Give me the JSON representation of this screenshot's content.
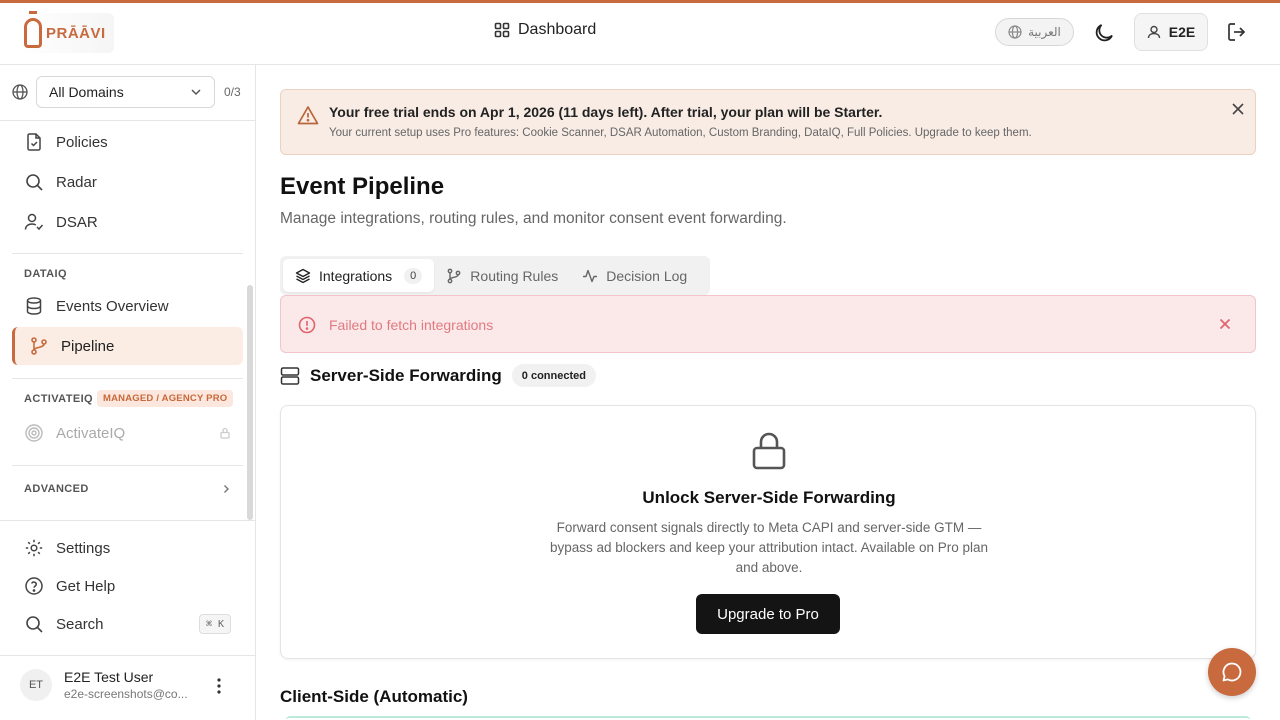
{
  "header": {
    "logo_text": "PRĀĀVI",
    "title": "Dashboard",
    "language_label": "العربية",
    "user_initials": "E2E"
  },
  "sidebar": {
    "domain_select": "All Domains",
    "domain_count": "0/3",
    "items_top": [
      {
        "label": "Policies",
        "icon": "document-check-icon"
      },
      {
        "label": "Radar",
        "icon": "search-icon"
      },
      {
        "label": "DSAR",
        "icon": "user-check-icon"
      }
    ],
    "dataiq_label": "DATAIQ",
    "dataiq_items": [
      {
        "label": "Events Overview",
        "icon": "database-icon"
      },
      {
        "label": "Pipeline",
        "icon": "git-branch-icon",
        "active": true
      }
    ],
    "activateiq_label": "ACTIVATEIQ",
    "activateiq_badge": "MANAGED / AGENCY PRO",
    "activateiq_item": {
      "label": "ActivateIQ",
      "icon": "target-icon",
      "locked": true
    },
    "advanced_label": "ADVANCED",
    "bottom_items": [
      {
        "label": "Settings",
        "icon": "gear-icon"
      },
      {
        "label": "Get Help",
        "icon": "help-circle-icon"
      },
      {
        "label": "Search",
        "icon": "search-icon",
        "shortcut": "⌘ K"
      }
    ],
    "user": {
      "initials": "ET",
      "name": "E2E Test User",
      "email": "e2e-screenshots@co..."
    }
  },
  "main": {
    "trial": {
      "title": "Your free trial ends on Apr 1, 2026 (11 days left). After trial, your plan will be Starter.",
      "subtitle": "Your current setup uses Pro features: Cookie Scanner, DSAR Automation, Custom Branding, DataIQ, Full Policies. Upgrade to keep them."
    },
    "page_title": "Event Pipeline",
    "page_subtitle": "Manage integrations, routing rules, and monitor consent event forwarding.",
    "tabs": [
      {
        "label": "Integrations",
        "count": "0",
        "active": true
      },
      {
        "label": "Routing Rules"
      },
      {
        "label": "Decision Log"
      }
    ],
    "error_text": "Failed to fetch integrations",
    "server_side": {
      "title": "Server-Side Forwarding",
      "badge": "0 connected"
    },
    "unlock": {
      "title": "Unlock Server-Side Forwarding",
      "description": "Forward consent signals directly to Meta CAPI and server-side GTM — bypass ad blockers and keep your attribution intact. Available on Pro plan and above.",
      "button": "Upgrade to Pro"
    },
    "client_side_title": "Client-Side (Automatic)"
  },
  "colors": {
    "accent": "#c86a3d",
    "trial_bg": "#f8ece5",
    "error_bg": "#fbe9ea",
    "error_text": "#e17a80"
  }
}
